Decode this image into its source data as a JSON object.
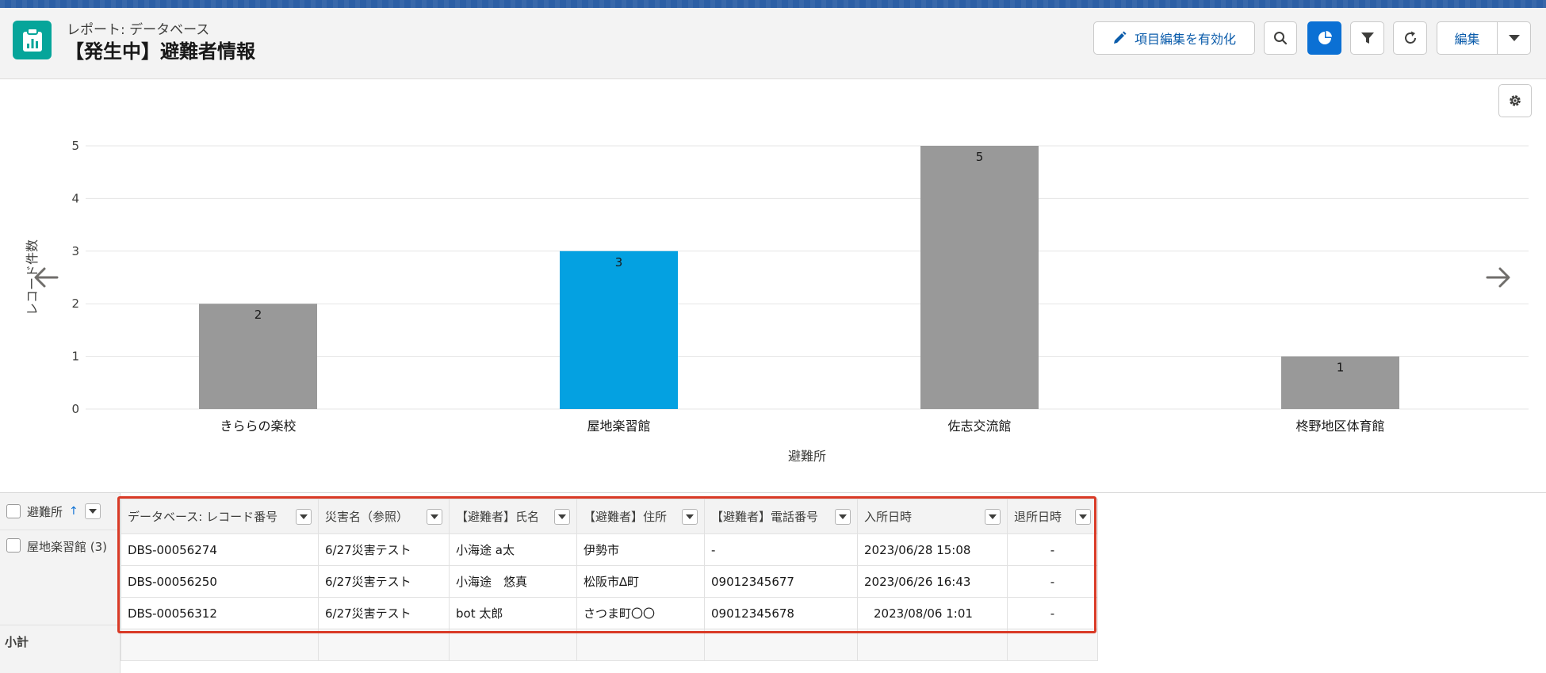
{
  "header": {
    "kicker": "レポート: データベース",
    "title": "【発生中】避難者情報",
    "icon": "report-icon",
    "buttons": {
      "inline_edit": "項目編集を有効化",
      "search": "search-icon",
      "chart": "chart-icon",
      "filter": "filter-icon",
      "refresh": "refresh-icon",
      "edit": "編集",
      "edit_menu": "chevron-down-icon"
    }
  },
  "colors": {
    "accent": "#0b70d4",
    "bar_default": "#999999",
    "bar_highlight": "#04a1e1",
    "highlight_frame": "#d93a26"
  },
  "chart_data": {
    "type": "bar",
    "categories": [
      "きららの楽校",
      "屋地楽習館",
      "佐志交流館",
      "柊野地区体育館"
    ],
    "values": [
      2,
      3,
      5,
      1
    ],
    "highlighted": "屋地楽習館",
    "xlabel": "避難所",
    "ylabel": "レコード件数",
    "ylim": [
      0,
      5
    ],
    "yticks": [
      0,
      1,
      2,
      3,
      4,
      5
    ],
    "grid": true,
    "data_labels": true
  },
  "table": {
    "group_header": "避難所",
    "columns": [
      "データベース: レコード番号",
      "災害名（参照）",
      "【避難者】氏名",
      "【避難者】住所",
      "【避難者】電話番号",
      "入所日時",
      "退所日時"
    ],
    "group": {
      "label": "屋地楽習館 (3)"
    },
    "rows": [
      [
        "DBS-00056274",
        "6/27災害テスト",
        "小海途 a太",
        "伊勢市",
        "-",
        "2023/06/28 15:08",
        "-"
      ],
      [
        "DBS-00056250",
        "6/27災害テスト",
        "小海途　悠真",
        "松阪市∆町",
        "09012345677",
        "2023/06/26 16:43",
        "-"
      ],
      [
        "DBS-00056312",
        "6/27災害テスト",
        "bot 太郎",
        "さつま町〇〇",
        "09012345678",
        "2023/08/06 1:01",
        "-"
      ]
    ],
    "subtotal": "小計"
  }
}
